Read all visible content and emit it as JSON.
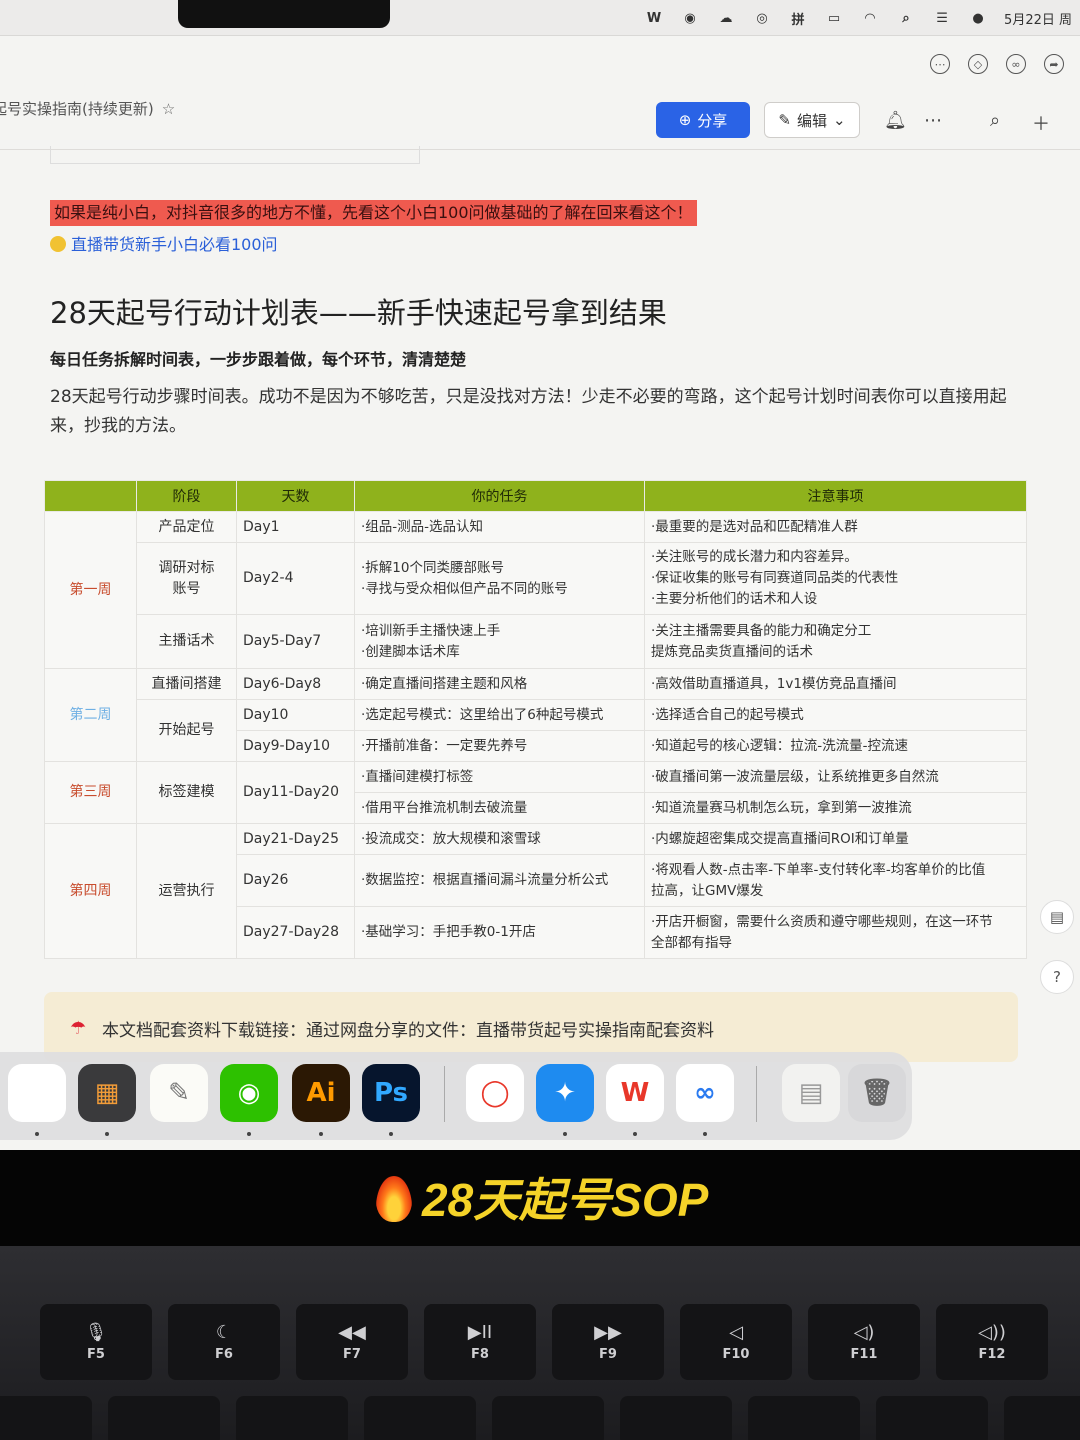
{
  "menubar": {
    "date": "5月22日 周",
    "tray_icons": [
      "wps-icon",
      "wechat-icon",
      "cloud-upload-icon",
      "sync-icon",
      "input-method-icon",
      "battery-icon",
      "wifi-icon",
      "search-icon",
      "control-center-icon",
      "siri-icon"
    ]
  },
  "doc": {
    "title": "起号实操指南(持续更新)",
    "share_label": "分享",
    "edit_label": "编辑"
  },
  "content": {
    "notice": "如果是纯小白，对抖音很多的地方不懂，先看这个小白100问做基础的了解在回来看这个！",
    "link": "直播带货新手小白必看100问",
    "heading": "28天起号行动计划表——新手快速起号拿到结果",
    "subheading": "每日任务拆解时间表，一步步跟着做，每个环节，清清楚楚",
    "paragraph": "28天起号行动步骤时间表。成功不是因为不够吃苦，只是没找对方法！少走不必要的弯路，这个起号计划时间表你可以直接用起来，抄我的方法。"
  },
  "table": {
    "headers": [
      "阶段",
      "天数",
      "你的任务",
      "注意事项"
    ],
    "week1": "第一周",
    "week2": "第二周",
    "week3": "第三周",
    "week4": "第四周",
    "r1": {
      "stage": "产品定位",
      "day": "Day1",
      "task": "·组品-测品-选品认知",
      "note": "·最重要的是选对品和匹配精准人群"
    },
    "r2": {
      "stage1": "调研对标",
      "stage2": "账号",
      "day": "Day2-4",
      "task1": "·拆解10个同类腰部账号",
      "task2": "·寻找与受众相似但产品不同的账号",
      "note1": "·关注账号的成长潜力和内容差异。",
      "note2": "·保证收集的账号有同赛道同品类的代表性",
      "note3": "·主要分析他们的话术和人设"
    },
    "r3": {
      "stage": "主播话术",
      "day": "Day5-Day7",
      "task1": "·培训新手主播快速上手",
      "task2": "·创建脚本话术库",
      "note1": "·关注主播需要具备的能力和确定分工",
      "note2": "提炼竞品卖货直播间的话术"
    },
    "r4": {
      "stage": "直播间搭建",
      "day": "Day6-Day8",
      "task": "·确定直播间搭建主题和风格",
      "note": "·高效借助直播道具，1v1模仿竞品直播间"
    },
    "r5": {
      "stage": "开始起号",
      "day": "Day10",
      "task": "·选定起号模式：这里给出了6种起号模式",
      "note": "·选择适合自己的起号模式"
    },
    "r6": {
      "day": "Day9-Day10",
      "task": "·开播前准备：一定要先养号",
      "note": "·知道起号的核心逻辑：拉流-洗流量-控流速"
    },
    "r7": {
      "stage": "标签建模",
      "day": "Day11-Day20",
      "task": "·直播间建模打标签",
      "note": "·破直播间第一波流量层级，让系统推更多自然流"
    },
    "r8": {
      "task": "·借用平台推流机制去破流量",
      "note": "·知道流量赛马机制怎么玩，拿到第一波推流"
    },
    "r9": {
      "stage": "运营执行",
      "day": "Day21-Day25",
      "task": "·投流成交：放大规模和滚雪球",
      "note": "·内螺旋超密集成交提高直播间ROI和订单量"
    },
    "r10": {
      "day": "Day26",
      "task": "·数据监控：根据直播间漏斗流量分析公式",
      "note1": "·将观看人数-点击率-下单率-支付转化率-均客单价的比值",
      "note2": "拉高，让GMV爆发"
    },
    "r11": {
      "day": "Day27-Day28",
      "task": "·基础学习：手把手教0-1开店",
      "note1": "·开店开橱窗，需要什么资质和遵守哪些规则，在这一环节",
      "note2": "全部都有指导"
    }
  },
  "callout": {
    "text": "本文档配套资料下载链接：通过网盘分享的文件：直播带货起号实操指南配套资料"
  },
  "dock": {
    "apps": [
      {
        "name": "feishu-app",
        "glyph": "",
        "bg": "#ffffff",
        "fg": "#1b6ef3"
      },
      {
        "name": "calculator-app",
        "glyph": "▦",
        "bg": "#3a3a3c",
        "fg": "#f29c38"
      },
      {
        "name": "textedit-app",
        "glyph": "✎",
        "bg": "#fbfbf7",
        "fg": "#777777"
      },
      {
        "name": "wechat-app",
        "glyph": "◉",
        "bg": "#2dc100",
        "fg": "#ffffff"
      },
      {
        "name": "illustrator-app",
        "glyph": "Ai",
        "bg": "#2b1804",
        "fg": "#ff9a00"
      },
      {
        "name": "photoshop-app",
        "glyph": "Ps",
        "bg": "#06152d",
        "fg": "#31a8ff"
      },
      {
        "name": "quark-app",
        "glyph": "◯",
        "bg": "#ffffff",
        "fg": "#e8372a"
      },
      {
        "name": "safari-app",
        "glyph": "✦",
        "bg": "#1e8bf0",
        "fg": "#ffffff"
      },
      {
        "name": "wps-app",
        "glyph": "W",
        "bg": "#ffffff",
        "fg": "#e8372a"
      },
      {
        "name": "baidu-netdisk-app",
        "glyph": "∞",
        "bg": "#ffffff",
        "fg": "#2a7af0"
      },
      {
        "name": "document-stack",
        "glyph": "▤",
        "bg": "#f2f2f0",
        "fg": "#999999"
      },
      {
        "name": "trash-app",
        "glyph": "🗑",
        "bg": "#d8d8da",
        "fg": "#666666"
      }
    ]
  },
  "banner": {
    "title": "28天起号SOP"
  },
  "keyboard": {
    "fkeys": [
      {
        "sym": "🎙",
        "label": "F5"
      },
      {
        "sym": "☾",
        "label": "F6"
      },
      {
        "sym": "◀◀",
        "label": "F7"
      },
      {
        "sym": "▶II",
        "label": "F8"
      },
      {
        "sym": "▶▶",
        "label": "F9"
      },
      {
        "sym": "◁",
        "label": "F10"
      },
      {
        "sym": "◁)",
        "label": "F11"
      },
      {
        "sym": "◁))",
        "label": "F12"
      }
    ]
  },
  "colors": {
    "header_green": "#8fb21c",
    "notice_red": "#ef5a4f",
    "share_blue": "#2a63e6",
    "banner_yellow": "#f5d328"
  }
}
